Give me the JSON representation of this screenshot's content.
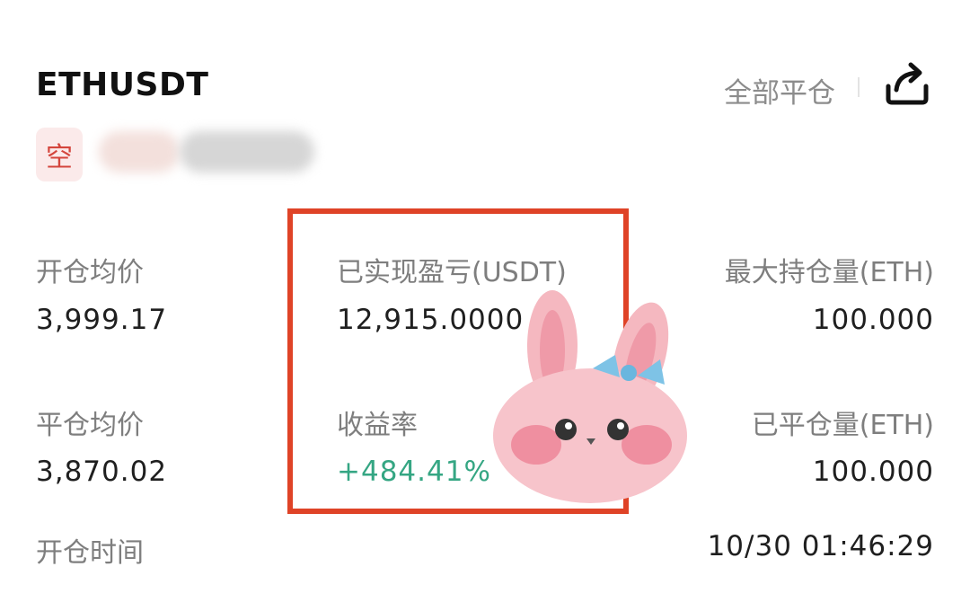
{
  "header": {
    "symbol": "ETHUSDT",
    "close_all_label": "全部平仓"
  },
  "position": {
    "side_label": "空"
  },
  "stats": {
    "avg_open_price": {
      "label": "开仓均价",
      "value": "3,999.17"
    },
    "realized_pnl": {
      "label": "已实现盈亏(USDT)",
      "value": "12,915.0000"
    },
    "max_position": {
      "label": "最大持仓量(ETH)",
      "value": "100.000"
    },
    "avg_close_price": {
      "label": "平仓均价",
      "value": "3,870.02"
    },
    "return_rate": {
      "label": "收益率",
      "value": "+484.41%"
    },
    "closed_amount": {
      "label": "已平仓量(ETH)",
      "value": "100.000"
    },
    "open_time": {
      "label": "开仓时间",
      "value": "10/30 01:46:29"
    }
  },
  "colors": {
    "positive": "#35a683",
    "highlight_border": "#df4327",
    "short_badge_text": "#d4463d",
    "short_badge_bg": "#fbeaea"
  },
  "icons": {
    "share": "share-icon",
    "sticker": "bunny-sticker"
  }
}
